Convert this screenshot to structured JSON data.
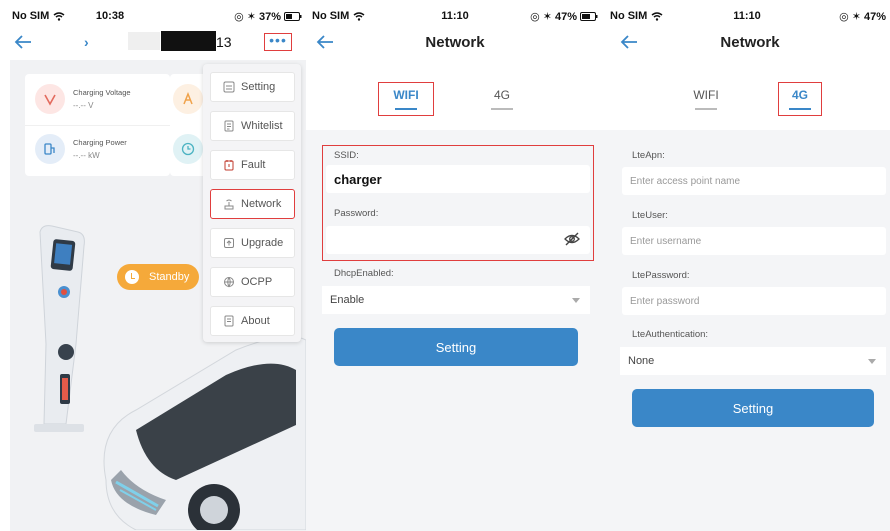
{
  "colors": {
    "accent": "#3a87c8",
    "highlight": "#e03e3e",
    "standby": "#f5a93a"
  },
  "screen1": {
    "status": {
      "carrier": "No SIM",
      "time": "10:38",
      "battery": "37%"
    },
    "device_suffix": "13",
    "more_label": "•••",
    "stats": [
      {
        "label": "Charging Voltage",
        "value": "--.-- V",
        "icon": "voltage-icon"
      },
      {
        "label": "Charging Power",
        "value": "--.-- kW",
        "icon": "power-icon"
      }
    ],
    "standby_label": "Standby",
    "menu": [
      {
        "label": "Setting",
        "icon": "setting-icon",
        "active": false
      },
      {
        "label": "Whitelist",
        "icon": "whitelist-icon",
        "active": false
      },
      {
        "label": "Fault",
        "icon": "fault-icon",
        "active": false
      },
      {
        "label": "Network",
        "icon": "network-icon",
        "active": true
      },
      {
        "label": "Upgrade",
        "icon": "upgrade-icon",
        "active": false
      },
      {
        "label": "OCPP",
        "icon": "ocpp-icon",
        "active": false
      },
      {
        "label": "About",
        "icon": "about-icon",
        "active": false
      }
    ]
  },
  "screen2": {
    "status": {
      "carrier": "No SIM",
      "time": "11:10",
      "battery": "47%"
    },
    "title": "Network",
    "tabs": [
      "WIFI",
      "4G"
    ],
    "active_tab": "WIFI",
    "ssid_label": "SSID:",
    "ssid_value": "charger",
    "password_label": "Password:",
    "password_value": "",
    "dhcp_label": "DhcpEnabled:",
    "dhcp_value": "Enable",
    "button": "Setting"
  },
  "screen3": {
    "status": {
      "carrier": "No SIM",
      "time": "11:10",
      "battery": "47%"
    },
    "title": "Network",
    "tabs": [
      "WIFI",
      "4G"
    ],
    "active_tab": "4G",
    "apn_label": "LteApn:",
    "apn_placeholder": "Enter access point name",
    "user_label": "LteUser:",
    "user_placeholder": "Enter username",
    "pass_label": "LtePassword:",
    "pass_placeholder": "Enter password",
    "auth_label": "LteAuthentication:",
    "auth_value": "None",
    "button": "Setting"
  }
}
